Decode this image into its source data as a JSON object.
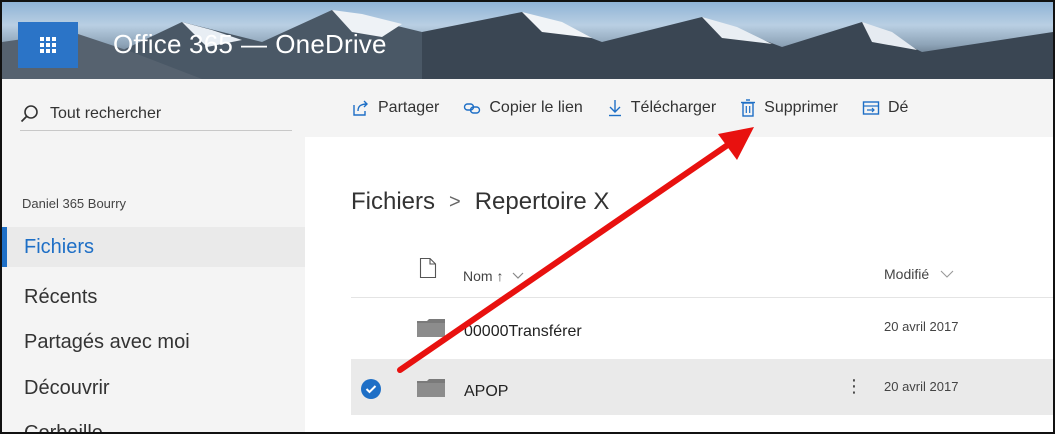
{
  "header": {
    "app_suite": "Office 365",
    "app_name": "OneDrive"
  },
  "search": {
    "label": "Tout rechercher"
  },
  "user": {
    "name": "Daniel 365 Bourry"
  },
  "nav": {
    "items": [
      {
        "label": "Fichiers",
        "active": true
      },
      {
        "label": "Récents"
      },
      {
        "label": "Partagés avec moi"
      },
      {
        "label": "Découvrir"
      },
      {
        "label": "Corbeille"
      }
    ]
  },
  "commands": {
    "share": "Partager",
    "copy_link": "Copier le lien",
    "download": "Télécharger",
    "delete": "Supprimer",
    "move_partial": "Dé"
  },
  "breadcrumb": {
    "root": "Fichiers",
    "separator": ">",
    "current": "Repertoire X"
  },
  "columns": {
    "name": "Nom ↑",
    "modified": "Modifié"
  },
  "files": [
    {
      "name": "00000Transférer",
      "modified": "20 avril 2017",
      "selected": false
    },
    {
      "name": "APOP",
      "modified": "20 avril 2017",
      "selected": true
    }
  ],
  "row_actions": {
    "more": "⋮"
  },
  "colors": {
    "accent": "#1e6fc6",
    "arrow": "#e8110f",
    "waffle_bg": "#2b74c7"
  }
}
